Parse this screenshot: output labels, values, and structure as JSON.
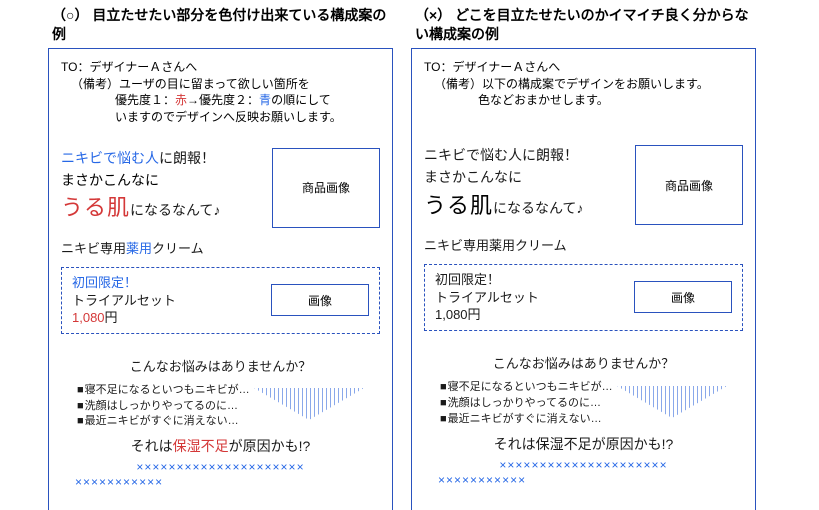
{
  "left": {
    "title_prefix": "（○）",
    "title_main": "目立たせたい部分を色付け出来ている構成案の例",
    "memo": {
      "to": "TO：デザイナーＡさんへ",
      "biko_label": "（備考）",
      "biko_l1a": "ユーザの目に留まって欲しい箇所を",
      "biko_l2a": "優先度１：",
      "biko_l2_red": "赤",
      "biko_l2b": "→優先度２：",
      "biko_l2_blue": "青",
      "biko_l2c": "の順にして",
      "biko_l3": "いますのでデザインへ反映お願いします。"
    },
    "headline": {
      "l1_blue": "ニキビで悩む人",
      "l1_rest": "に朗報！",
      "l2": "まさかこんなに",
      "l3_big": "うる肌",
      "l3_rest": "になるなんて♪"
    },
    "img_label": "商品画像",
    "sub_a": "ニキビ専用",
    "sub_blue": "薬用",
    "sub_b": "クリーム",
    "trial": {
      "l1_blue": "初回限定！",
      "l2": "トライアルセット",
      "price_red": "1,080",
      "price_unit": "円"
    },
    "img2_label": "画像",
    "worries": {
      "q": "こんなお悩みはありませんか？",
      "items": [
        "寝不足になるといつもニキビが…",
        "洗顔はしっかりやってるのに…",
        "最近ニキビがすぐに消えない…"
      ]
    },
    "answer_a": "それは",
    "answer_red": "保湿不足",
    "answer_b": "が原因かも!?",
    "xline1": "×××××××××××××××××××××",
    "xline2": "×××××××××××"
  },
  "right": {
    "title_prefix": "（×）",
    "title_main": "どこを目立たせたいのかイマイチ良く分からない構成案の例",
    "memo": {
      "to": "TO：デザイナーＡさんへ",
      "biko_label": "（備考）",
      "biko_l1": "以下の構成案でデザインをお願いします。",
      "biko_l2": "色などおまかせします。"
    },
    "headline": {
      "l1": "ニキビで悩む人に朗報！",
      "l2": "まさかこんなに",
      "l3_big": "うる肌",
      "l3_rest": "になるなんて♪"
    },
    "img_label": "商品画像",
    "sub": "ニキビ専用薬用クリーム",
    "trial": {
      "l1": "初回限定！",
      "l2": "トライアルセット",
      "price": "1,080円"
    },
    "img2_label": "画像",
    "worries": {
      "q": "こんなお悩みはありませんか？",
      "items": [
        "寝不足になるといつもニキビが…",
        "洗顔はしっかりやってるのに…",
        "最近ニキビがすぐに消えない…"
      ]
    },
    "answer": "それは保湿不足が原因かも!?",
    "xline1": "×××××××××××××××××××××",
    "xline2": "×××××××××××"
  }
}
